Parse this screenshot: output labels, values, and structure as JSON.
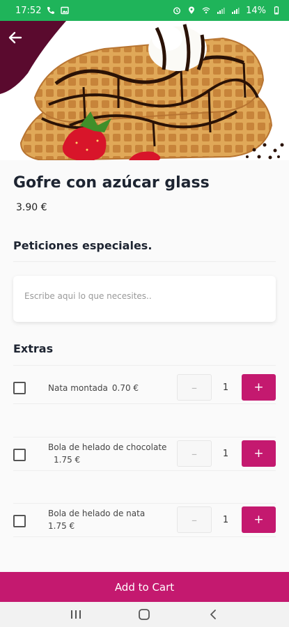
{
  "status_bar": {
    "time": "17:52",
    "battery": "14%"
  },
  "product": {
    "title": "Gofre con azúcar glass",
    "price": "3.90 €"
  },
  "special_requests": {
    "title": "Peticiones especiales.",
    "placeholder": "Escribe aqui lo que necesites.."
  },
  "extras": {
    "title": "Extras",
    "items": [
      {
        "name": "Nata montada",
        "price": "0.70 €",
        "quantity": "1",
        "minus": "–",
        "plus": "+"
      },
      {
        "name": "Bola de helado de chocolate",
        "price": "1.75 €",
        "quantity": "1",
        "minus": "–",
        "plus": "+"
      },
      {
        "name": "Bola de helado de nata",
        "price": "1.75 €",
        "quantity": "1",
        "minus": "–",
        "plus": "+"
      }
    ]
  },
  "cart": {
    "button_label": "Add to Cart"
  },
  "colors": {
    "accent": "#c4196f",
    "status_bar": "#1fb45a",
    "hero_corner": "#5a0a2e"
  },
  "icons": {
    "back": "arrow-left-icon",
    "nav_recent": "recent-apps-icon",
    "nav_home": "home-icon",
    "nav_back": "nav-back-icon"
  }
}
